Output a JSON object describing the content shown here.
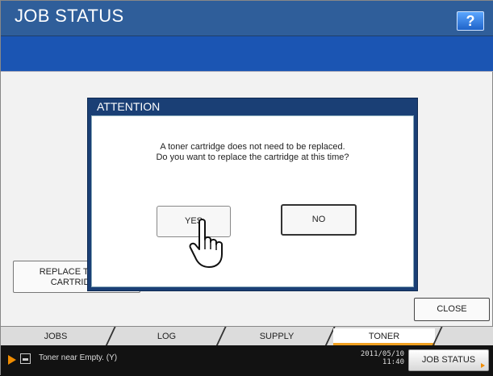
{
  "header": {
    "title": "JOB STATUS",
    "help_label": "?"
  },
  "main": {
    "replace_button_lines": [
      "REPLACE TONER",
      "CARTRIDGE"
    ],
    "close_label": "CLOSE"
  },
  "tabs": [
    {
      "label": "JOBS",
      "active": false
    },
    {
      "label": "LOG",
      "active": false
    },
    {
      "label": "SUPPLY",
      "active": false
    },
    {
      "label": "TONER",
      "active": true
    }
  ],
  "dialog": {
    "title": "ATTENTION",
    "message_line1": "A toner cartridge does not need to be replaced.",
    "message_line2": "Do you want to replace the cartridge at this time?",
    "yes_label": "YES",
    "no_label": "NO"
  },
  "statusbar": {
    "status_text": "Toner near Empty. (Y)",
    "date": "2011/05/10",
    "time": "11:40",
    "job_status_label": "JOB STATUS"
  },
  "colors": {
    "title_bar": "#2f5e9a",
    "blue_bar": "#1b55b3",
    "dialog_header": "#1a3f75",
    "accent_orange": "#f08c00"
  }
}
